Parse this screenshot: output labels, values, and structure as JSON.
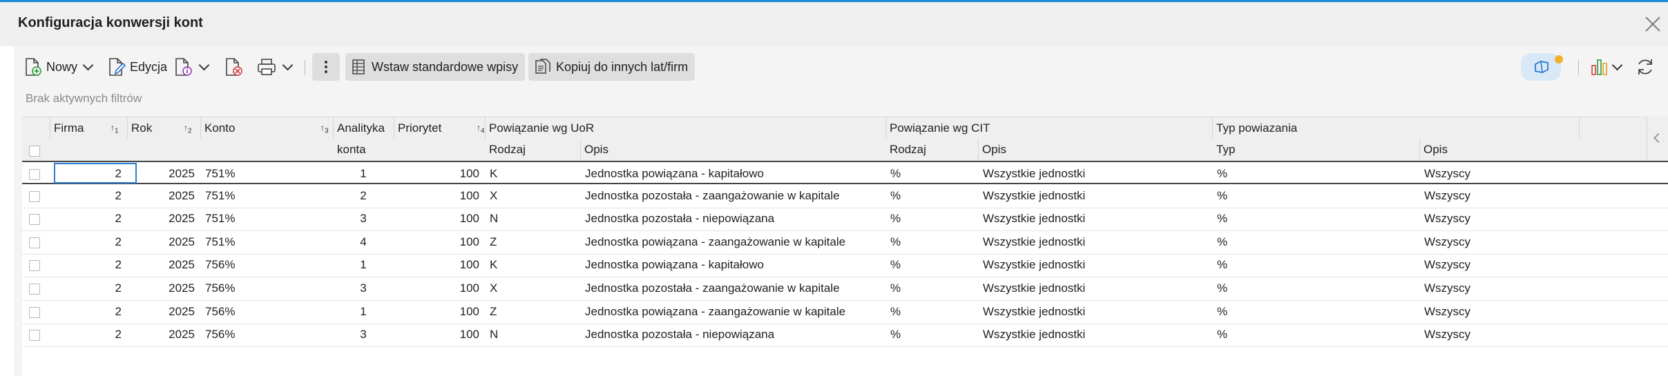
{
  "window": {
    "title": "Konfiguracja konwersji kont"
  },
  "toolbar": {
    "new_label": "Nowy",
    "edit_label": "Edycja",
    "insert_label": "Wstaw standardowe wpisy",
    "copy_label": "Kopiuj do innych lat/firm",
    "accent": "#1a8ad4"
  },
  "filters": {
    "text": "Brak aktywnych filtrów"
  },
  "grid": {
    "headers": {
      "firma": "Firma",
      "rok": "Rok",
      "konto": "Konto",
      "analityka_1": "Analityka",
      "analityka_2": "konta",
      "priorytet": "Priorytet",
      "uor": "Powiązanie wg UoR",
      "cit": "Powiązanie wg CIT",
      "typ_powiazania": "Typ powiazania",
      "uor_rodzaj": "Rodzaj",
      "uor_opis": "Opis",
      "cit_rodzaj": "Rodzaj",
      "cit_opis": "Opis",
      "typ": "Typ",
      "typ_opis": "Opis"
    },
    "sort_indicators": [
      "1",
      "2",
      "3",
      "4"
    ],
    "rows": [
      {
        "firma": "2",
        "rok": "2025",
        "konto": "751%",
        "analityka": "1",
        "priorytet": "100",
        "uor_rodzaj": "K",
        "uor_opis": "Jednostka powiązana - kapitałowo",
        "cit_rodzaj": "%",
        "cit_opis": "Wszystkie jednostki",
        "typ": "%",
        "typ_opis": "Wszyscy"
      },
      {
        "firma": "2",
        "rok": "2025",
        "konto": "751%",
        "analityka": "2",
        "priorytet": "100",
        "uor_rodzaj": "X",
        "uor_opis": "Jednostka pozostała - zaangażowanie w kapitale",
        "cit_rodzaj": "%",
        "cit_opis": "Wszystkie jednostki",
        "typ": "%",
        "typ_opis": "Wszyscy"
      },
      {
        "firma": "2",
        "rok": "2025",
        "konto": "751%",
        "analityka": "3",
        "priorytet": "100",
        "uor_rodzaj": "N",
        "uor_opis": "Jednostka pozostała - niepowiązana",
        "cit_rodzaj": "%",
        "cit_opis": "Wszystkie jednostki",
        "typ": "%",
        "typ_opis": "Wszyscy"
      },
      {
        "firma": "2",
        "rok": "2025",
        "konto": "751%",
        "analityka": "4",
        "priorytet": "100",
        "uor_rodzaj": "Z",
        "uor_opis": "Jednostka powiązana - zaangażowanie w kapitale",
        "cit_rodzaj": "%",
        "cit_opis": "Wszystkie jednostki",
        "typ": "%",
        "typ_opis": "Wszyscy"
      },
      {
        "firma": "2",
        "rok": "2025",
        "konto": "756%",
        "analityka": "1",
        "priorytet": "100",
        "uor_rodzaj": "K",
        "uor_opis": "Jednostka powiązana - kapitałowo",
        "cit_rodzaj": "%",
        "cit_opis": "Wszystkie jednostki",
        "typ": "%",
        "typ_opis": "Wszyscy"
      },
      {
        "firma": "2",
        "rok": "2025",
        "konto": "756%",
        "analityka": "3",
        "priorytet": "100",
        "uor_rodzaj": "X",
        "uor_opis": "Jednostka pozostała - zaangażowanie w kapitale",
        "cit_rodzaj": "%",
        "cit_opis": "Wszystkie jednostki",
        "typ": "%",
        "typ_opis": "Wszyscy"
      },
      {
        "firma": "2",
        "rok": "2025",
        "konto": "756%",
        "analityka": "1",
        "priorytet": "100",
        "uor_rodzaj": "Z",
        "uor_opis": "Jednostka powiązana - zaangażowanie w kapitale",
        "cit_rodzaj": "%",
        "cit_opis": "Wszystkie jednostki",
        "typ": "%",
        "typ_opis": "Wszyscy"
      },
      {
        "firma": "2",
        "rok": "2025",
        "konto": "756%",
        "analityka": "3",
        "priorytet": "100",
        "uor_rodzaj": "N",
        "uor_opis": "Jednostka pozostała - niepowiązana",
        "cit_rodzaj": "%",
        "cit_opis": "Wszystkie jednostki",
        "typ": "%",
        "typ_opis": "Wszyscy"
      }
    ]
  }
}
